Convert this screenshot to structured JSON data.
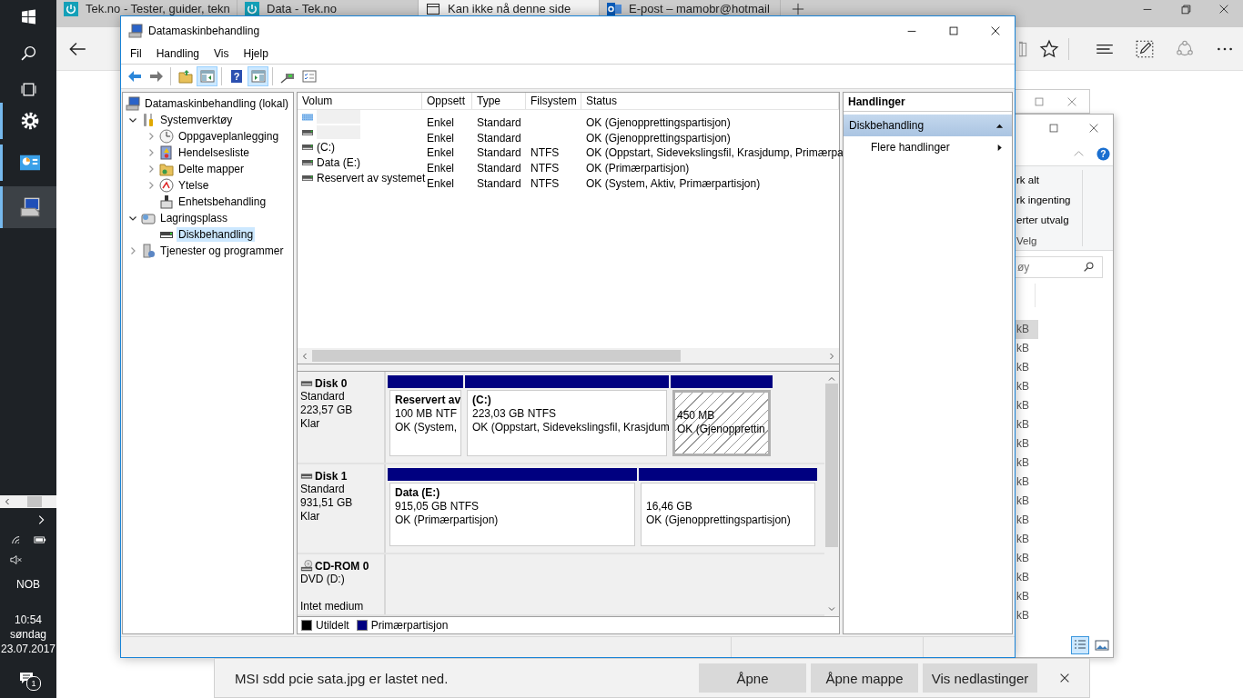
{
  "taskbar": {
    "apps": [
      {
        "running": true,
        "selected": false
      },
      {
        "running": true,
        "selected": false
      },
      {
        "running": true,
        "selected": true
      }
    ],
    "language": "NOB",
    "time": "10:54",
    "day": "søndag",
    "date": "23.07.2017",
    "notification_count": "1"
  },
  "browser": {
    "tabs": [
      {
        "title": "Tek.no - Tester, guider, tekn",
        "selected": false
      },
      {
        "title": "Data - Tek.no",
        "selected": false
      },
      {
        "title": "Kan ikke nå denne side",
        "selected": true
      },
      {
        "title": "E-post – mamobr@hotmail",
        "selected": false
      }
    ]
  },
  "background_window": {
    "ribbon_items": [
      "rk alt",
      "rk ingenting",
      "erter utvalg"
    ],
    "help_glyph": "?",
    "ribbon_group": "Velg",
    "search": {
      "placeholder": "øy"
    },
    "sizes": [
      {
        "text": "kB",
        "selected": true
      },
      {
        "text": "kB",
        "selected": false
      },
      {
        "text": "kB",
        "selected": false
      },
      {
        "text": "kB",
        "selected": false
      },
      {
        "text": "kB",
        "selected": false
      },
      {
        "text": "kB",
        "selected": false
      },
      {
        "text": "kB",
        "selected": false
      },
      {
        "text": "kB",
        "selected": false
      },
      {
        "text": "kB",
        "selected": false
      },
      {
        "text": "kB",
        "selected": false
      },
      {
        "text": "kB",
        "selected": false
      },
      {
        "text": "kB",
        "selected": false
      },
      {
        "text": "kB",
        "selected": false
      },
      {
        "text": "kB",
        "selected": false
      },
      {
        "text": "kB",
        "selected": false
      },
      {
        "text": "kB",
        "selected": false
      }
    ]
  },
  "window": {
    "title": "Datamaskinbehandling",
    "menu": [
      "Fil",
      "Handling",
      "Vis",
      "Hjelp"
    ],
    "toolbar": [
      {
        "pressed": false
      },
      {
        "pressed": false
      },
      {
        "pressed": false
      },
      {
        "pressed": true
      },
      {
        "pressed": false,
        "glyph": "?"
      },
      {
        "pressed": true
      },
      {
        "pressed": false
      },
      {
        "pressed": false
      }
    ],
    "tree": [
      {
        "label": "Datamaskinbehandling (lokal)",
        "selected": false,
        "children": [
          {
            "label": "Systemverktøy",
            "expanded": true,
            "selected": false,
            "children": [
              {
                "label": "Oppgaveplanlegging",
                "expanded": false,
                "selected": false
              },
              {
                "label": "Hendelsesliste",
                "expanded": false,
                "selected": false
              },
              {
                "label": "Delte mapper",
                "expanded": false,
                "selected": false
              },
              {
                "label": "Ytelse",
                "expanded": false,
                "selected": false
              },
              {
                "label": "Enhetsbehandling",
                "selected": false
              }
            ]
          },
          {
            "label": "Lagringsplass",
            "expanded": true,
            "selected": false,
            "children": [
              {
                "label": "Diskbehandling",
                "selected": true
              }
            ]
          },
          {
            "label": "Tjenester og programmer",
            "expanded": false,
            "selected": false
          }
        ]
      }
    ],
    "table": {
      "columns": [
        "Volum",
        "Oppsett",
        "Type",
        "Filsystem",
        "Status"
      ],
      "rows": [
        {
          "kind": "striped",
          "layout": "Enkel",
          "type": "Standard",
          "status": "OK (Gjenopprettingspartisjon)"
        },
        {
          "kind": "drive",
          "layout": "Enkel",
          "type": "Standard",
          "status": "OK (Gjenopprettingspartisjon)"
        },
        {
          "kind": "drive",
          "volume": "(C:)",
          "layout": "Enkel",
          "type": "Standard",
          "filesystem": "NTFS",
          "status": "OK (Oppstart, Sidevekslingsfil, Krasjdump, Primærpa"
        },
        {
          "kind": "drive",
          "volume": "Data (E:)",
          "layout": "Enkel",
          "type": "Standard",
          "filesystem": "NTFS",
          "status": "OK (Primærpartisjon)"
        },
        {
          "kind": "drive",
          "volume": "Reservert av systemet",
          "layout": "Enkel",
          "type": "Standard",
          "filesystem": "NTFS",
          "status": "OK (System, Aktiv, Primærpartisjon)"
        }
      ]
    },
    "disks": [
      {
        "kind": "disk",
        "name": "Disk 0",
        "type": "Standard",
        "size": "223,57 GB",
        "state": "Klar",
        "partitions": [
          {
            "label": "Reservert av",
            "size": "100 MB NTF",
            "status": "OK (System,",
            "selected": false
          },
          {
            "label": "(C:)",
            "size": "223,03 GB NTFS",
            "status": "OK (Oppstart, Sidevekslingsfil, Krasjdum",
            "selected": false
          },
          {
            "size": "450 MB",
            "status": "OK (Gjenopprettin",
            "selected": true
          }
        ]
      },
      {
        "kind": "disk",
        "name": "Disk 1",
        "type": "Standard",
        "size": "931,51 GB",
        "state": "Klar",
        "partitions": [
          {
            "label": "Data  (E:)",
            "size": "915,05 GB NTFS",
            "status": "OK (Primærpartisjon)",
            "selected": false
          },
          {
            "size": "16,46 GB",
            "status": "OK (Gjenopprettingspartisjon)",
            "selected": false
          }
        ]
      },
      {
        "kind": "cdrom",
        "name": "CD-ROM 0",
        "type": "DVD (D:)",
        "state": "Intet medium"
      }
    ],
    "legend": [
      {
        "label": "Utildelt",
        "color": "#000000"
      },
      {
        "label": "Primærpartisjon",
        "color": "#000080"
      }
    ],
    "actions": {
      "title": "Handlinger",
      "section": {
        "label": "Diskbehandling",
        "expanded": true
      },
      "items": [
        {
          "label": "Flere handlinger"
        }
      ]
    }
  },
  "download_bar": {
    "message": "MSI sdd pcie sata.jpg er lastet ned.",
    "buttons": [
      "Åpne",
      "Åpne mappe",
      "Vis nedlastinger"
    ]
  }
}
